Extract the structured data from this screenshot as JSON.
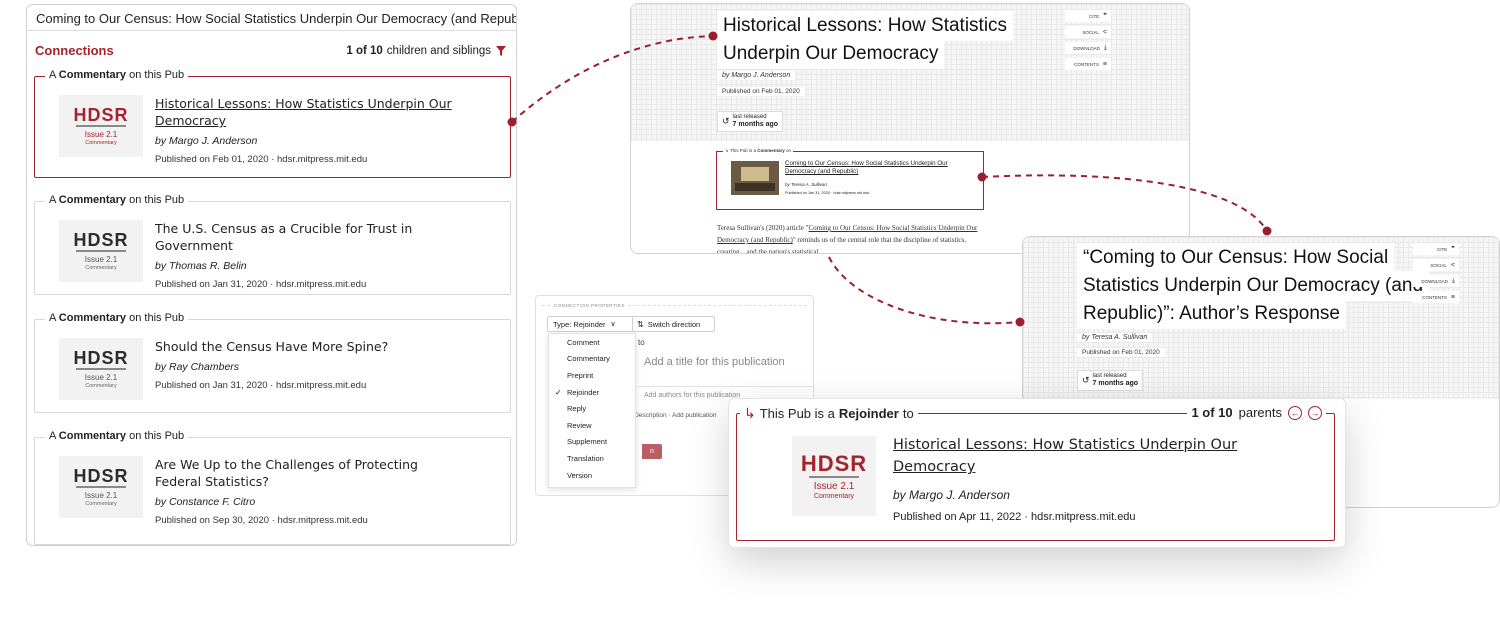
{
  "left_panel": {
    "title": "Coming to Our Census: How Social Statistics Underpin Our Democracy (and Republic)",
    "connections_label": "Connections",
    "count_strong": "1 of 10",
    "count_rest": "children and siblings",
    "items": [
      {
        "legend_prefix": "A",
        "legend_kind": "Commentary",
        "legend_suffix": "on this Pub",
        "thumb_logo": "HDSR",
        "thumb_issue": "Issue 2.1",
        "thumb_kind": "Commentary",
        "title": "Historical Lessons: How Statistics Underpin Our Democracy",
        "author": "by Margo J. Anderson",
        "published": "Published on Feb 01, 2020 · hdsr.mitpress.mit.edu"
      },
      {
        "legend_prefix": "A",
        "legend_kind": "Commentary",
        "legend_suffix": "on this Pub",
        "thumb_logo": "HDSR",
        "thumb_issue": "Issue 2.1",
        "thumb_kind": "Commentary",
        "title": "The U.S. Census as a Crucible for Trust in Government",
        "author": "by Thomas R. Belin",
        "published": "Published on Jan 31, 2020 · hdsr.mitpress.mit.edu"
      },
      {
        "legend_prefix": "A",
        "legend_kind": "Commentary",
        "legend_suffix": "on this Pub",
        "thumb_logo": "HDSR",
        "thumb_issue": "Issue 2.1",
        "thumb_kind": "Commentary",
        "title": "Should the Census Have More Spine?",
        "author": "by Ray Chambers",
        "published": "Published on Jan 31, 2020 · hdsr.mitpress.mit.edu"
      },
      {
        "legend_prefix": "A",
        "legend_kind": "Commentary",
        "legend_suffix": "on this Pub",
        "thumb_logo": "HDSR",
        "thumb_issue": "Issue 2.1",
        "thumb_kind": "Commentary",
        "title": "Are We Up to the Challenges of Protecting Federal Statistics?",
        "author": "by Constance F. Citro",
        "published": "Published on Sep 30, 2020 · hdsr.mitpress.mit.edu"
      }
    ]
  },
  "page_top": {
    "title_line1": "Historical Lessons: How Statistics",
    "title_line2": "Underpin Our Democracy",
    "author": "by Margo J. Anderson",
    "published_label": "Published on",
    "published_date": "Feb 01, 2020",
    "released_label": "last released",
    "released_value": "7 months ago",
    "side_buttons": [
      "CITE",
      "SOCIAL",
      "DOWNLOAD",
      "CONTENTS"
    ],
    "mini_legend_prefix": "This Pub is a",
    "mini_legend_kind": "Commentary",
    "mini_legend_suffix": "on",
    "mini_title": "Coming to Our Census: How Social Statistics Underpin Our Democracy (and Republic)",
    "mini_author": "by Teresa A. Sullivan",
    "mini_pub": "Published on Jan 31, 2020 · hdsr.mitpress.mit.edu",
    "body_before": "Teresa Sullivan's (2020) article \"",
    "body_link": "Coming to Our Census: How Social Statistics Underpin Our Democracy (and Republic)",
    "body_after": "\" reminds us of the central role that the discipline of statistics, creating... and the nation's statistical"
  },
  "page_right": {
    "title_line1": "“Coming to Our Census: How Social",
    "title_line2": "Statistics Underpin Our Democracy (and",
    "title_line3": "Republic)”: Author’s Response",
    "author": "by Teresa A. Sullivan",
    "published_label": "Published on",
    "published_date": "Feb 01, 2020",
    "released_label": "last released",
    "released_value": "7 months ago",
    "side_buttons": [
      "CITE",
      "SOCIAL",
      "DOWNLOAD",
      "CONTENTS"
    ]
  },
  "dropdown": {
    "section_label": "CONNECTION PROPERTIES",
    "type_label": "Type: Rejoinder",
    "switch_label": "Switch direction",
    "to_label": "to",
    "title_placeholder": "Add a title for this publication",
    "authors_placeholder": "Add authors for this publication",
    "desc_text": "Show Description · Add publication",
    "red_button": "n",
    "options": [
      "Comment",
      "Commentary",
      "Preprint",
      "Rejoinder",
      "Reply",
      "Review",
      "Supplement",
      "Translation",
      "Version"
    ],
    "selected": "Rejoinder"
  },
  "detail_card": {
    "legend_prefix": "This Pub is a",
    "legend_kind": "Rejoinder",
    "legend_suffix": "to",
    "count_strong": "1 of 10",
    "count_rest": "parents",
    "thumb_logo": "HDSR",
    "thumb_issue": "Issue 2.1",
    "thumb_kind": "Commentary",
    "title": "Historical Lessons: How Statistics Underpin Our Democracy",
    "author": "by Margo J. Anderson",
    "published": "Published on Apr 11, 2022 · hdsr.mitpress.mit.edu"
  },
  "colors": {
    "accent": "#a5232f",
    "connector": "#9b1f2e"
  },
  "icons": [
    "filter-icon",
    "history-icon",
    "check-icon",
    "switch-arrows-icon",
    "chevron-down-icon",
    "arrow-left-circle-icon",
    "arrow-right-circle-icon",
    "return-arrow-icon"
  ]
}
